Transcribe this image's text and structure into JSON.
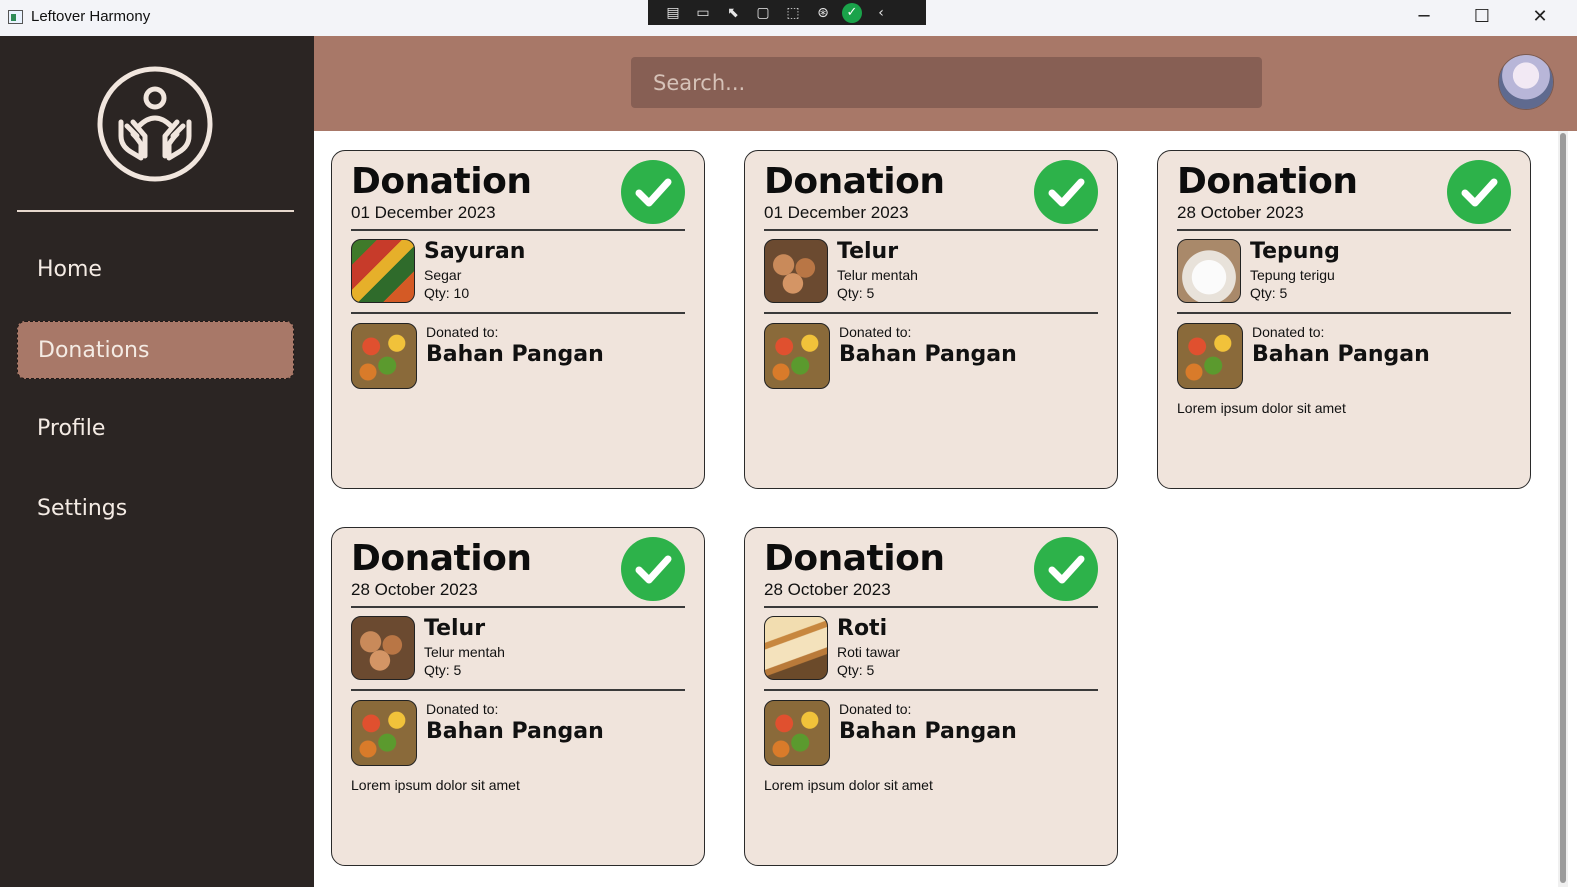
{
  "window": {
    "title": "Leftover Harmony",
    "controls": {
      "minimize": "─",
      "maximize": "☐",
      "close": "✕"
    },
    "devtools": [
      "▤",
      "▭",
      "⬉",
      "▢",
      "⬚",
      "⊛",
      "✓",
      "‹"
    ]
  },
  "sidebar": {
    "logo_icon": "hands-holding-person-icon",
    "items": [
      {
        "label": "Home"
      },
      {
        "label": "Donations",
        "active": true
      },
      {
        "label": "Profile"
      },
      {
        "label": "Settings"
      }
    ]
  },
  "header": {
    "search_placeholder": "Search..."
  },
  "colors": {
    "sidebar": "#2b2523",
    "accent": "#a87868",
    "search_bg": "#875f54",
    "card_bg": "#f0e4dc",
    "check": "#2db24a"
  },
  "donations": [
    {
      "title": "Donation",
      "date": "01 December 2023",
      "item": {
        "name": "Sayuran",
        "desc": "Segar",
        "qty": "Qty: 10",
        "image": "vegetables"
      },
      "donated_label": "Donated to:",
      "recipient": "Bahan Pangan",
      "note": ""
    },
    {
      "title": "Donation",
      "date": "01 December 2023",
      "item": {
        "name": "Telur",
        "desc": "Telur mentah",
        "qty": "Qty: 5",
        "image": "eggs"
      },
      "donated_label": "Donated to:",
      "recipient": "Bahan Pangan",
      "note": ""
    },
    {
      "title": "Donation",
      "date": "28 October 2023",
      "item": {
        "name": "Tepung",
        "desc": "Tepung terigu",
        "qty": "Qty: 5",
        "image": "flour"
      },
      "donated_label": "Donated to:",
      "recipient": "Bahan Pangan",
      "note": "Lorem ipsum dolor sit amet"
    },
    {
      "title": "Donation",
      "date": "28 October 2023",
      "item": {
        "name": "Telur",
        "desc": "Telur mentah",
        "qty": "Qty: 5",
        "image": "eggs"
      },
      "donated_label": "Donated to:",
      "recipient": "Bahan Pangan",
      "note": "Lorem ipsum dolor sit amet"
    },
    {
      "title": "Donation",
      "date": "28 October 2023",
      "item": {
        "name": "Roti",
        "desc": "Roti tawar",
        "qty": "Qty: 5",
        "image": "bread"
      },
      "donated_label": "Donated to:",
      "recipient": "Bahan Pangan",
      "note": "Lorem ipsum dolor sit amet"
    }
  ]
}
